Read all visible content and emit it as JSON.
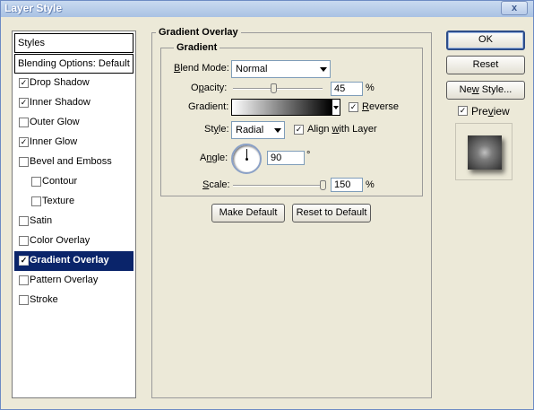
{
  "window": {
    "title": "Layer Style",
    "close_label": "x"
  },
  "styles_panel": {
    "header": "Styles",
    "blending_options": "Blending Options: Default",
    "items": [
      {
        "label": "Drop Shadow",
        "checked": true,
        "mark": "✓"
      },
      {
        "label": "Inner Shadow",
        "checked": true,
        "mark": "✓"
      },
      {
        "label": "Outer Glow",
        "checked": false,
        "mark": ""
      },
      {
        "label": "Inner Glow",
        "checked": true,
        "mark": "✓"
      },
      {
        "label": "Bevel and Emboss",
        "checked": false,
        "mark": ""
      },
      {
        "label": "Contour",
        "checked": false,
        "mark": ""
      },
      {
        "label": "Texture",
        "checked": false,
        "mark": ""
      },
      {
        "label": "Satin",
        "checked": false,
        "mark": ""
      },
      {
        "label": "Color Overlay",
        "checked": false,
        "mark": ""
      },
      {
        "label": "Gradient Overlay",
        "checked": true,
        "mark": "✓",
        "selected": true
      },
      {
        "label": "Pattern Overlay",
        "checked": false,
        "mark": ""
      },
      {
        "label": "Stroke",
        "checked": false,
        "mark": ""
      }
    ]
  },
  "gradient_overlay": {
    "group_title": "Gradient Overlay",
    "subgroup_title": "Gradient",
    "blend_mode": {
      "label_u": "B",
      "label_rest": "lend Mode:",
      "value": "Normal"
    },
    "opacity": {
      "label_pre": "O",
      "label_u": "p",
      "label_rest": "acity:",
      "value": "45",
      "unit": "%",
      "level_percent": 45
    },
    "gradient": {
      "label": "Gradient:",
      "reverse_label_u": "R",
      "reverse_label_rest": "everse",
      "reverse_checked": true,
      "reverse_mark": "✓",
      "colors": [
        "#ffffff",
        "#000000"
      ]
    },
    "style": {
      "label_pre": "St",
      "label_u": "y",
      "label_rest": "le:",
      "value": "Radial",
      "align_label_pre": "Align ",
      "align_label_u": "w",
      "align_label_rest": "ith Layer",
      "align_checked": true,
      "align_mark": "✓"
    },
    "angle": {
      "label_pre": "A",
      "label_u": "n",
      "label_rest": "gle:",
      "value": "90",
      "unit": "°"
    },
    "scale": {
      "label_u": "S",
      "label_rest": "cale:",
      "value": "150",
      "unit": "%",
      "level_percent": 100
    },
    "make_default": "Make Default",
    "reset_to_default": "Reset to Default"
  },
  "actions": {
    "ok": "OK",
    "reset": "Reset",
    "new_style_pre": "Ne",
    "new_style_u": "w",
    "new_style_rest": " Style...",
    "preview_label_pre": "Pre",
    "preview_label_u": "v",
    "preview_label_rest": "iew",
    "preview_checked": true,
    "preview_mark": "✓"
  }
}
